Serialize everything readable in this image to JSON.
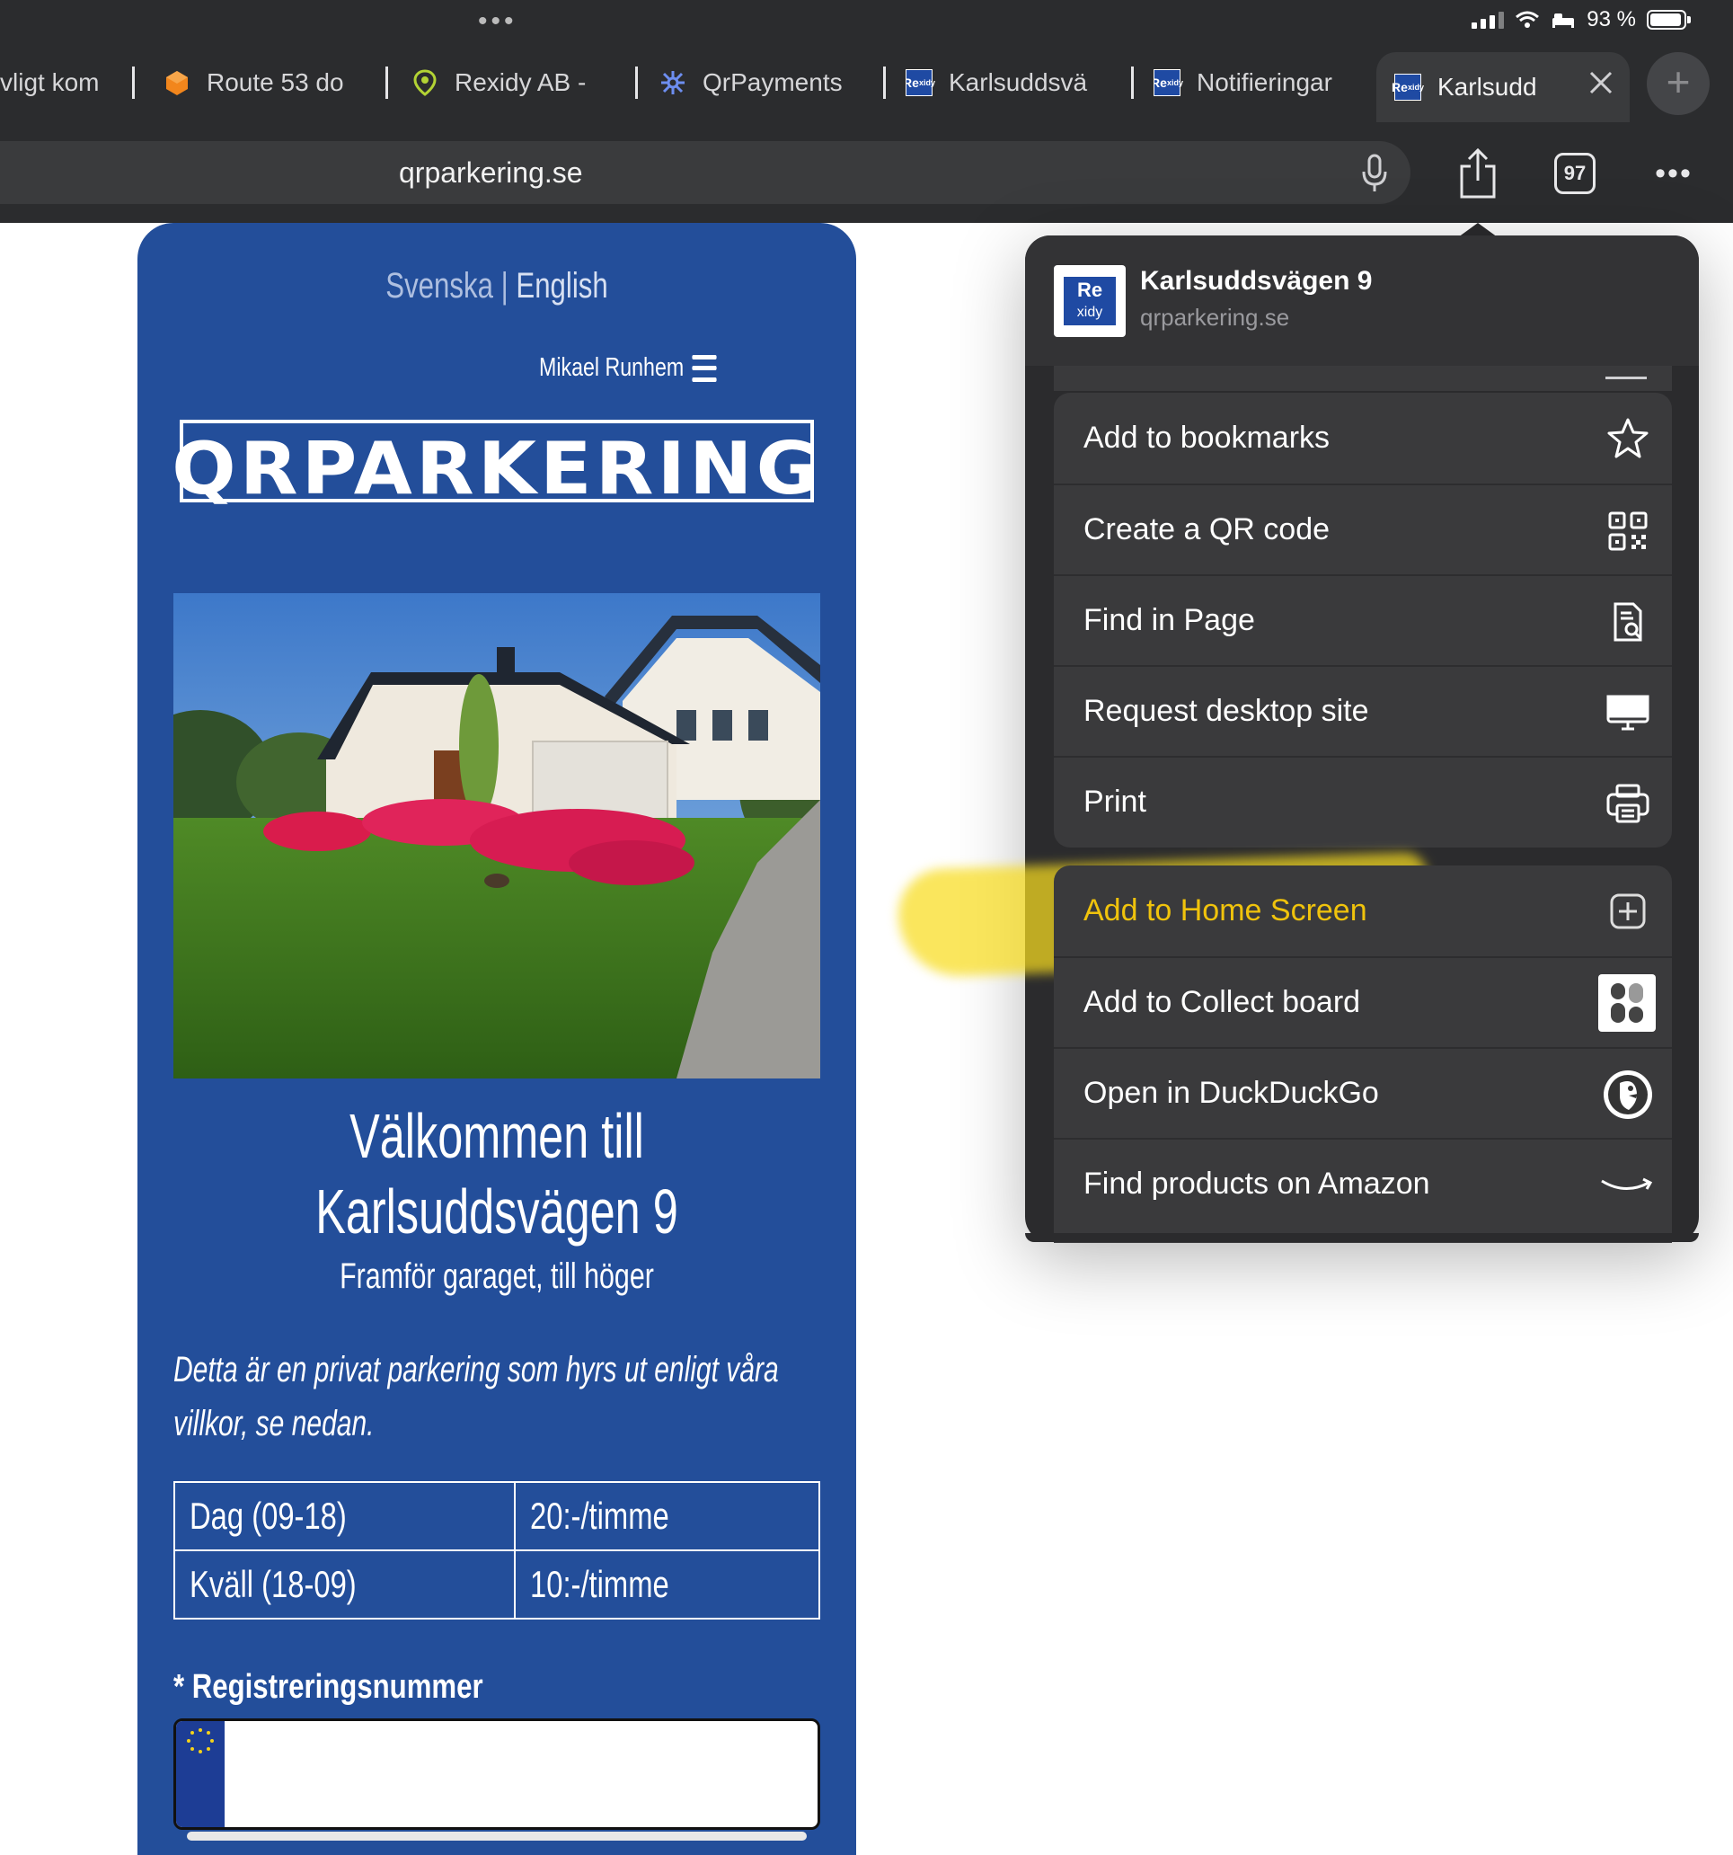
{
  "status_bar": {
    "battery": "93 %"
  },
  "tabs": [
    {
      "label": "vligt kom"
    },
    {
      "label": "Route 53 do"
    },
    {
      "label": "Rexidy AB - "
    },
    {
      "label": "QrPayments"
    },
    {
      "label": "Karlsuddsvä"
    },
    {
      "label": "Notifieringar"
    },
    {
      "label": "Karlsudd"
    }
  ],
  "address_bar": {
    "url": "qrparkering.se",
    "tab_count": "97"
  },
  "page": {
    "lang_sv": "Svenska",
    "lang_sep": " | ",
    "lang_en": "English",
    "user_name": "Mikael Runhem",
    "logo_text": "QRPARKERING",
    "welcome_line1": "Välkommen till",
    "welcome_line2": "Karlsuddsvägen 9",
    "subtitle": "Framför garaget, till höger",
    "description": "Detta är en privat parkering som hyrs ut enligt våra villkor, se nedan.",
    "prices": [
      {
        "period": "Dag (09-18)",
        "price": "20:-/timme"
      },
      {
        "period": "Kväll (18-09)",
        "price": "10:-/timme"
      }
    ],
    "reg_label": "* Registreringsnummer",
    "reg_value": ""
  },
  "share_sheet": {
    "title": "Karlsuddsvägen 9",
    "url": "qrparkering.se",
    "app_icon_line1": "Re",
    "app_icon_line2": "xidy",
    "group1": [
      {
        "label": "Add to bookmarks",
        "icon": "star-icon"
      },
      {
        "label": "Create a QR code",
        "icon": "qr-code-icon"
      },
      {
        "label": "Find in Page",
        "icon": "find-in-page-icon"
      },
      {
        "label": "Request desktop site",
        "icon": "desktop-icon"
      },
      {
        "label": "Print",
        "icon": "printer-icon"
      }
    ],
    "group2": [
      {
        "label": "Add to Home Screen",
        "icon": "add-square-icon"
      },
      {
        "label": "Add to Collect board",
        "icon": "collect-board-icon"
      },
      {
        "label": "Open in DuckDuckGo",
        "icon": "duckduckgo-icon"
      },
      {
        "label": "Find products on Amazon",
        "icon": "amazon-smile-icon"
      }
    ]
  },
  "colors": {
    "page_blue": "#234e9a",
    "highlight": "#f8dd1e",
    "highlight_text": "#f0c30c"
  }
}
